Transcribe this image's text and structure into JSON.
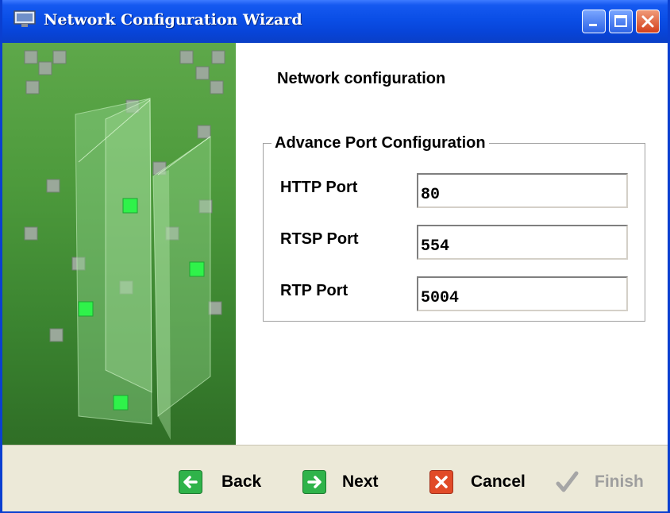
{
  "window": {
    "title": "Network Configuration Wizard",
    "controls": [
      "minimize-icon",
      "maximize-icon",
      "close-icon"
    ]
  },
  "page": {
    "heading": "Network configuration",
    "group_title": "Advance Port Configuration",
    "fields": [
      {
        "label": "HTTP Port",
        "value": "80"
      },
      {
        "label": "RTSP Port",
        "value": "554"
      },
      {
        "label": "RTP Port",
        "value": "5004"
      }
    ]
  },
  "footer": {
    "back": {
      "label": "Back",
      "icon": "green-left-arrow-icon"
    },
    "next": {
      "label": "Next",
      "icon": "green-right-arrow-icon"
    },
    "cancel": {
      "label": "Cancel",
      "icon": "red-x-icon"
    },
    "finish": {
      "label": "Finish",
      "icon": "gray-checkmark-icon",
      "enabled": false
    }
  },
  "colors": {
    "titlebar": "#0a4ee6",
    "side_panel": "#4d9a3c",
    "footer": "#ece9d8",
    "accent_green": "#2fb34a",
    "cancel_red": "#e14b28"
  }
}
